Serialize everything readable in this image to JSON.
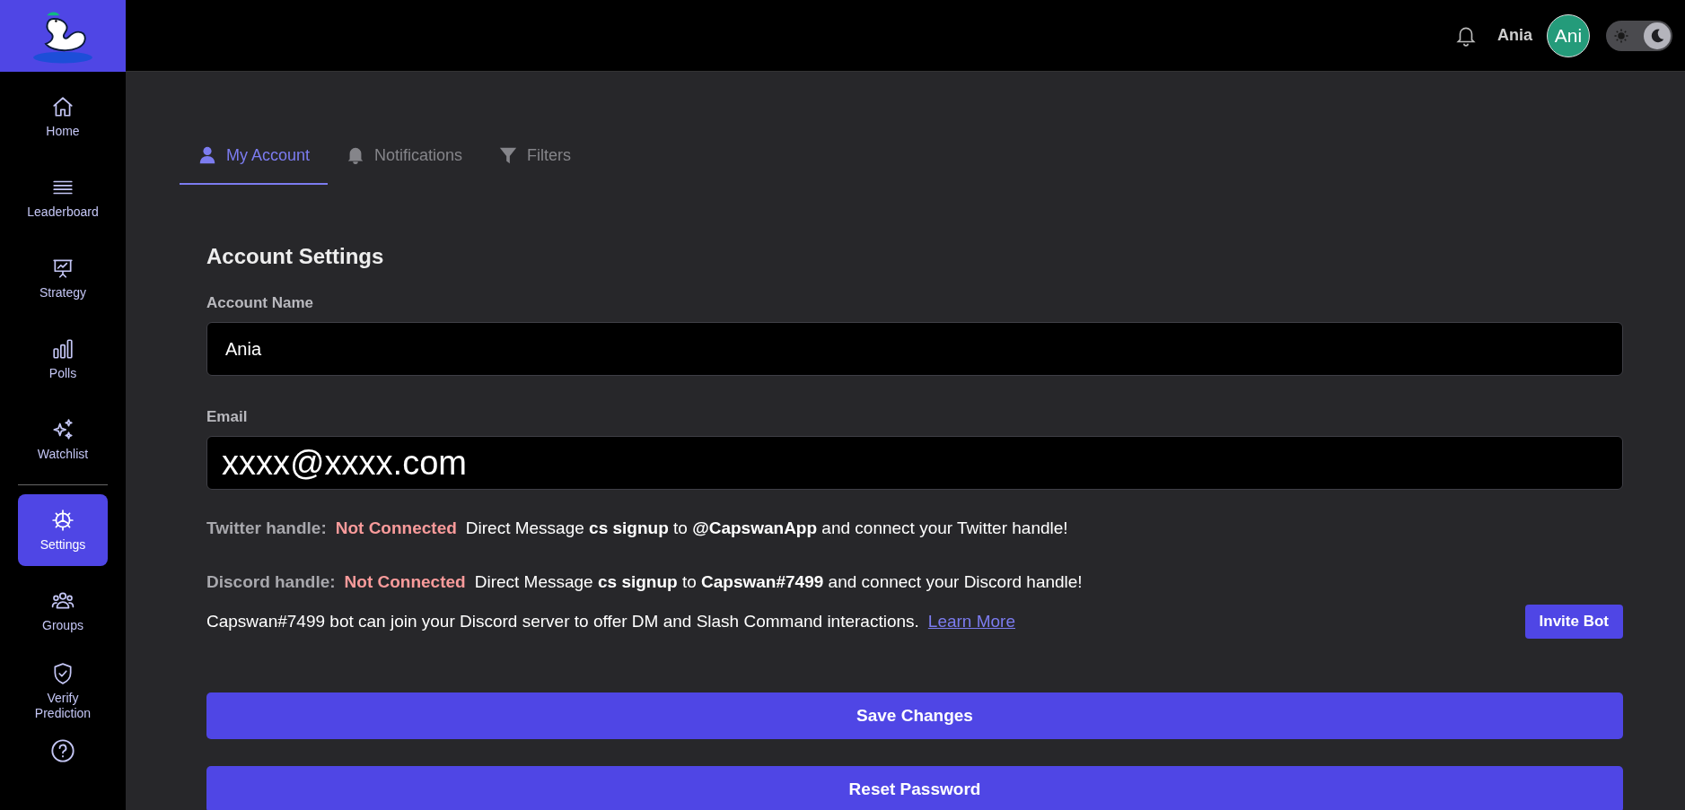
{
  "header": {
    "username": "Ania",
    "avatar_initials": "Ani",
    "dark_mode": true
  },
  "sidebar": {
    "items": [
      {
        "label": "Home",
        "kind": "home",
        "selected": false
      },
      {
        "label": "Leaderboard",
        "kind": "list",
        "selected": false
      },
      {
        "label": "Strategy",
        "kind": "board",
        "selected": false
      },
      {
        "label": "Polls",
        "kind": "bars",
        "selected": false
      },
      {
        "label": "Watchlist",
        "kind": "sparkle",
        "selected": false
      },
      {
        "label": "Settings",
        "kind": "gear",
        "selected": true
      },
      {
        "label": "Groups",
        "kind": "group",
        "selected": false
      },
      {
        "label": "Verify Prediction",
        "kind": "shield",
        "selected": false
      }
    ]
  },
  "tabs": [
    {
      "label": "My Account",
      "kind": "user",
      "selected": true
    },
    {
      "label": "Notifications",
      "kind": "bell",
      "selected": false
    },
    {
      "label": "Filters",
      "kind": "funnel",
      "selected": false
    }
  ],
  "section_title": "Account Settings",
  "fields": [
    {
      "label": "Account Name",
      "value": "Ania",
      "kind": "normal"
    },
    {
      "label": "Email",
      "value": "xxxx@xxxx.com",
      "kind": "large"
    }
  ],
  "handles": [
    {
      "label": "Twitter handle:",
      "status": "Not Connected",
      "connected": false,
      "message": "Direct Message **cs signup** to **@CapswanApp** and connect your Twitter handle!"
    },
    {
      "label": "Discord handle:",
      "status": "Not Connected",
      "connected": false,
      "message": "Direct Message **cs signup** to **Capswan#7499** and connect your Discord handle!"
    }
  ],
  "bot_note": {
    "text": "Capswan#7499 bot can join your Discord server to offer DM and Slash Command interactions.",
    "link": "Learn More",
    "button": "Invite Bot"
  },
  "buttons": [
    "Save Changes",
    "Reset Password"
  ]
}
